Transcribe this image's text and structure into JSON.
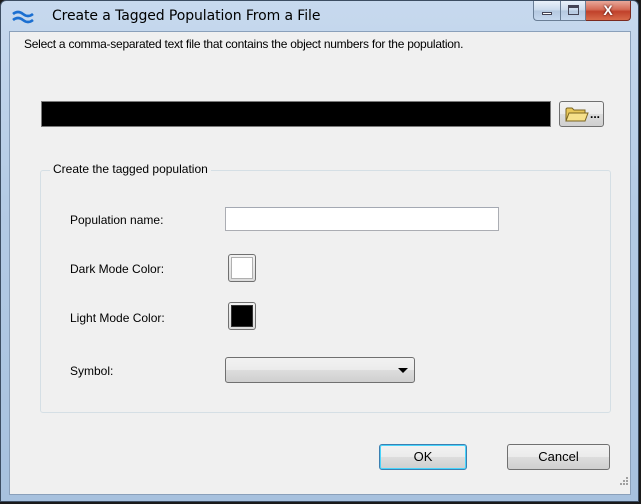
{
  "window": {
    "title": "Create a Tagged Population From a File",
    "close_glyph": "X"
  },
  "file_section": {
    "instruction": "Select a comma-separated text file that contains the object numbers for the population.",
    "file_path_value": "",
    "browse_label": "..."
  },
  "group": {
    "legend": "Create the tagged population",
    "population_name_label": "Population name:",
    "population_name_value": "",
    "dark_mode_label": "Dark Mode Color:",
    "dark_mode_color": "#ffffff",
    "light_mode_label": "Light Mode Color:",
    "light_mode_color": "#000000",
    "symbol_label": "Symbol:",
    "symbol_value": ""
  },
  "buttons": {
    "ok_label": "OK",
    "cancel_label": "Cancel"
  },
  "icons": {
    "app": "wave-icon",
    "browse": "folder-icon"
  }
}
